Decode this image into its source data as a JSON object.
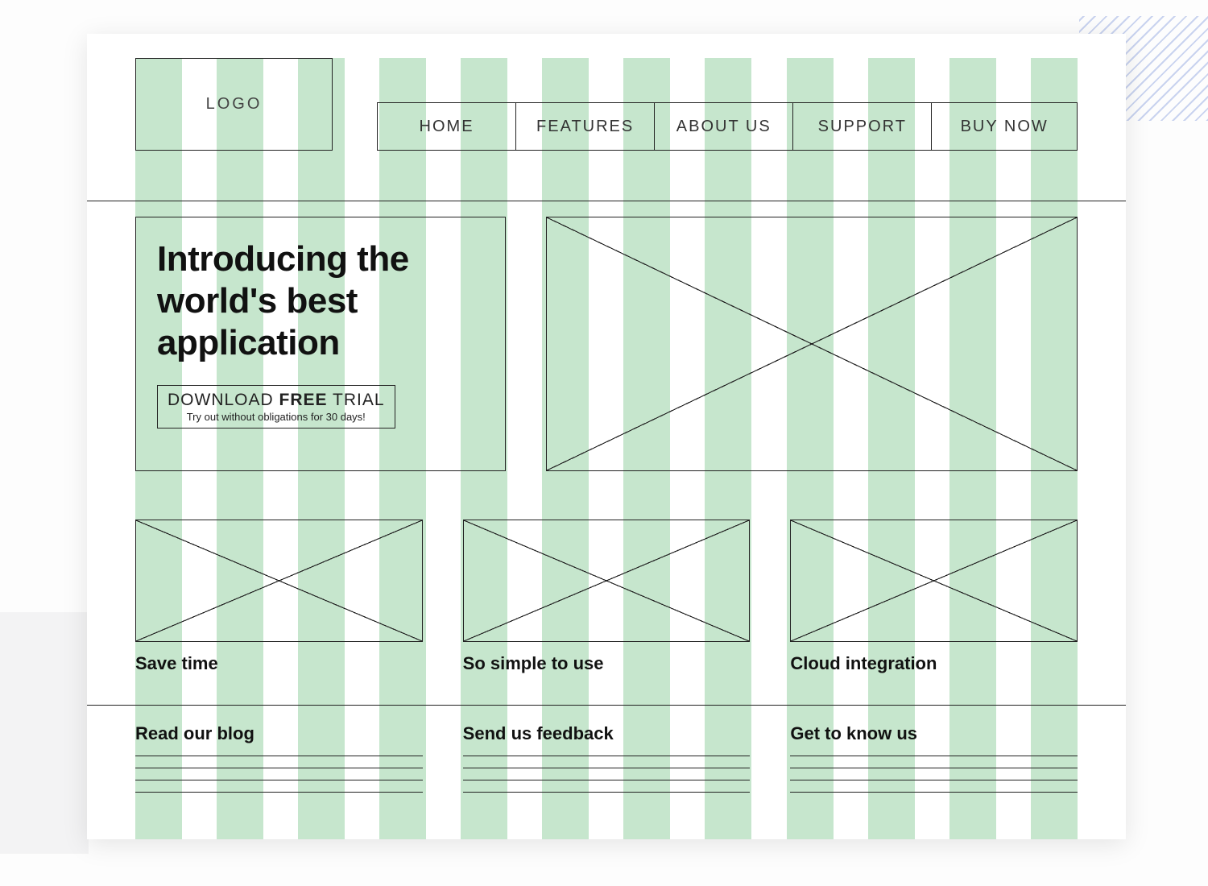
{
  "colors": {
    "column": "#c6e6cd",
    "border": "#222222",
    "text": "#111111"
  },
  "header": {
    "logo": "LOGO",
    "nav": [
      "HOME",
      "FEATURES",
      "ABOUT US",
      "SUPPORT",
      "BUY NOW"
    ]
  },
  "hero": {
    "title": "Introducing the world's best application",
    "cta_prefix": "DOWNLOAD ",
    "cta_strong": "FREE",
    "cta_suffix": " TRIAL",
    "cta_sub": "Try out without obligations for 30 days!"
  },
  "features": [
    {
      "label": "Save time"
    },
    {
      "label": "So simple to use"
    },
    {
      "label": "Cloud integration"
    }
  ],
  "footer": [
    {
      "title": "Read our blog"
    },
    {
      "title": "Send us feedback"
    },
    {
      "title": "Get to know us"
    }
  ]
}
